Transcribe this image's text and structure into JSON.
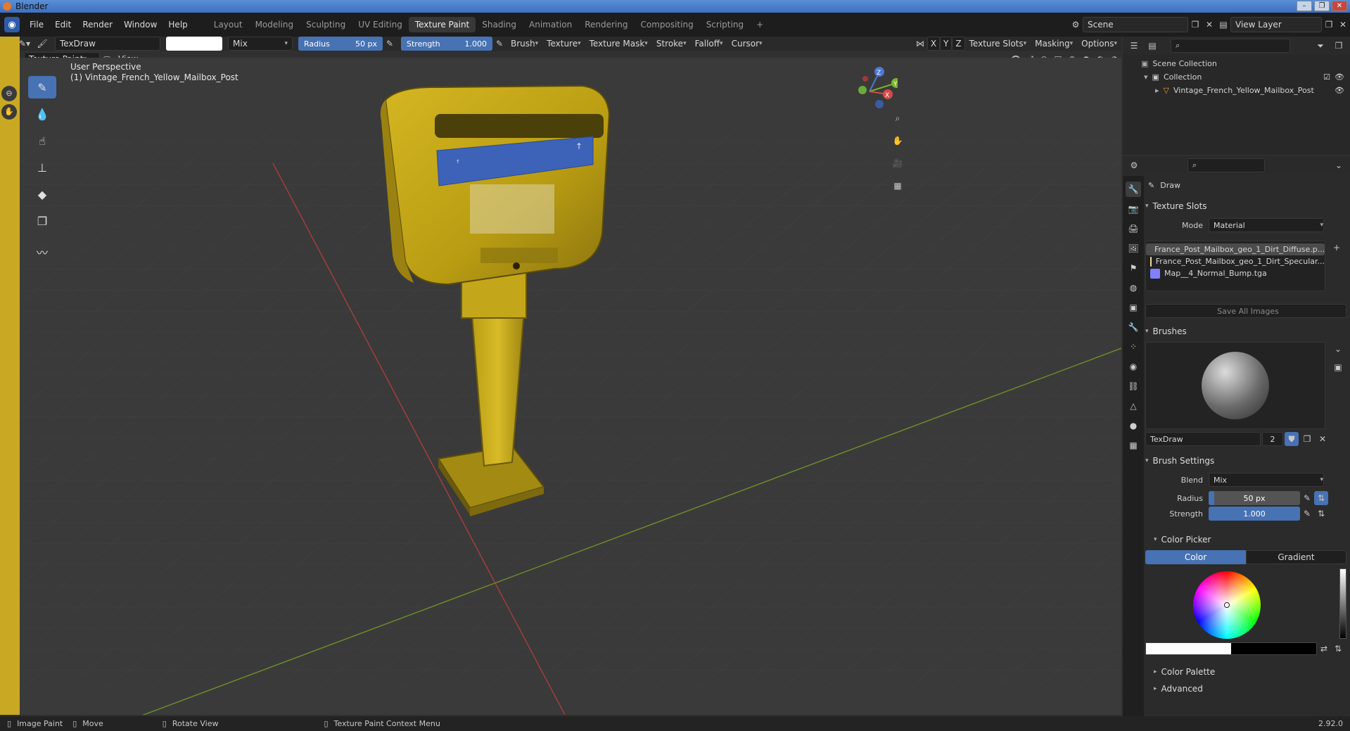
{
  "window": {
    "title": "Blender",
    "controls": [
      "–",
      "❐",
      "✕"
    ]
  },
  "menu": {
    "items": [
      "File",
      "Edit",
      "Render",
      "Window",
      "Help"
    ]
  },
  "workspaces": [
    "Layout",
    "Modeling",
    "Sculpting",
    "UV Editing",
    "Texture Paint",
    "Shading",
    "Animation",
    "Rendering",
    "Compositing",
    "Scripting"
  ],
  "active_workspace": "Texture Paint",
  "scene": {
    "name": "Scene",
    "view_layer": "View Layer"
  },
  "tool_header": {
    "brush_name": "TexDraw",
    "blend": "Mix",
    "radius_label": "Radius",
    "radius_value": "50 px",
    "strength_label": "Strength",
    "strength_value": "1.000",
    "menus": [
      "Brush",
      "Texture",
      "Texture Mask",
      "Stroke",
      "Falloff",
      "Cursor"
    ],
    "axes": [
      "X",
      "Y",
      "Z"
    ],
    "right_menus": [
      "Texture Slots",
      "Masking",
      "Options"
    ]
  },
  "mode_header": {
    "mode": "Texture Paint",
    "view": "View"
  },
  "viewport": {
    "perspective": "User Perspective",
    "object": "(1) Vintage_French_Yellow_Mailbox_Post",
    "gizmo_axes": [
      "Z",
      "Y",
      "X"
    ],
    "colors": {
      "mailbox": "#c7a916",
      "mailbox_dark": "#7d6a0f",
      "plate": "#3d63b8",
      "grid_red": "#a33c3c",
      "grid_green": "#6c8a2a"
    }
  },
  "outliner": {
    "scene_collection": "Scene Collection",
    "collection": "Collection",
    "object": "Vintage_French_Yellow_Mailbox_Post"
  },
  "properties": {
    "tool": "Draw",
    "texture_slots": {
      "header": "Texture Slots",
      "mode_label": "Mode",
      "mode_value": "Material",
      "slots": [
        {
          "name": "France_Post_Mailbox_geo_1_Dirt_Diffuse.p...",
          "color": "#c7a916",
          "selected": true
        },
        {
          "name": "France_Post_Mailbox_geo_1_Dirt_Specular...",
          "color": "#e8dba0",
          "selected": false
        },
        {
          "name": "Map__4_Normal_Bump.tga",
          "color": "#8080ff",
          "selected": false
        }
      ],
      "save_all": "Save All Images"
    },
    "brushes": {
      "header": "Brushes",
      "name": "TexDraw",
      "users": "2"
    },
    "brush_settings": {
      "header": "Brush Settings",
      "blend_label": "Blend",
      "blend_value": "Mix",
      "radius_label": "Radius",
      "radius_value": "50 px",
      "strength_label": "Strength",
      "strength_value": "1.000",
      "color_picker": "Color Picker",
      "color_tab": "Color",
      "gradient_tab": "Gradient",
      "color_palette": "Color Palette",
      "advanced": "Advanced"
    }
  },
  "statusbar": {
    "items": [
      "Image Paint",
      "Move",
      "Rotate View",
      "Texture Paint Context Menu"
    ],
    "version": "2.92.0"
  }
}
